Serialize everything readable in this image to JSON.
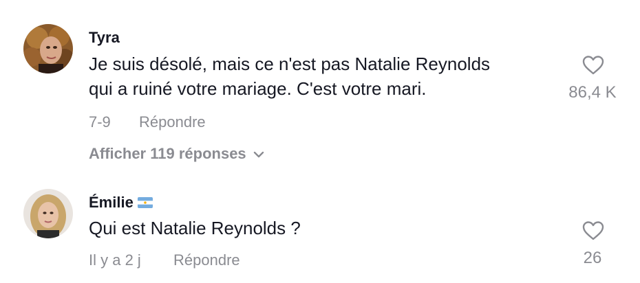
{
  "comments": [
    {
      "username": "Tyra",
      "text_lines": [
        "Je suis désolé, mais ce n'est pas Natalie Reynolds",
        "qui a ruiné votre mariage. C'est votre mari."
      ],
      "date": "7-9",
      "reply_label": "Répondre",
      "likes": "86,4 K",
      "view_replies_label": "Afficher 119 réponses",
      "avatar_icon": "avatar-curly-hair"
    },
    {
      "username": "Émilie",
      "flag": "argentina-flag-icon",
      "text_lines": [
        "Qui est Natalie Reynolds ?"
      ],
      "date": "Il y a 2 j",
      "reply_label": "Répondre",
      "likes": "26",
      "avatar_icon": "avatar-blonde-hair"
    }
  ],
  "colors": {
    "primary_text": "#161823",
    "secondary_text": "#8a8b91",
    "background": "#ffffff"
  }
}
